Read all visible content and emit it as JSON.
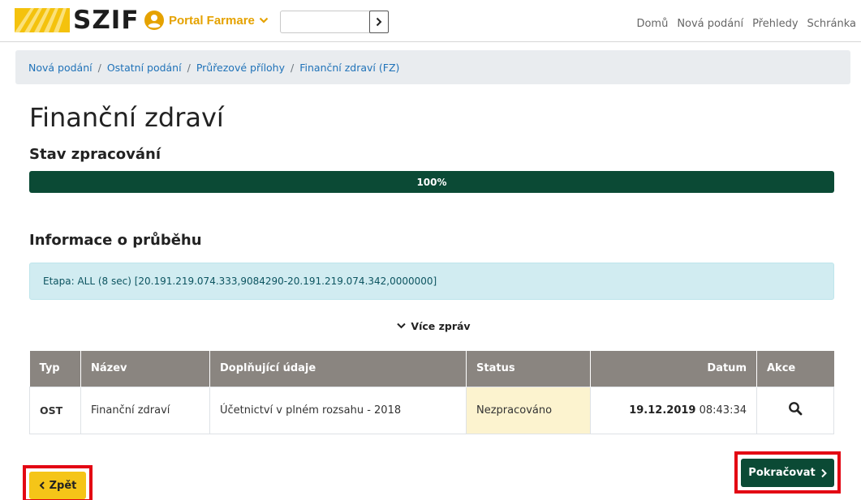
{
  "header": {
    "logo_text": "SZIF",
    "portal_label": "Portal Farmare",
    "search_value": "",
    "nav": [
      "Domů",
      "Nová podání",
      "Přehledy",
      "Schránka"
    ]
  },
  "breadcrumb": [
    "Nová podání",
    "Ostatní podání",
    "Průřezové přílohy",
    "Finanční zdraví (FZ)"
  ],
  "page_title": "Finanční zdraví",
  "stav_title": "Stav zpracování",
  "progress": {
    "value": 100,
    "label": "100%"
  },
  "info_title": "Informace o průběhu",
  "info_message": "Etapa: ALL (8 sec) [20.191.219.074.333,9084290-20.191.219.074.342,0000000]",
  "more_label": "Více zpráv",
  "table": {
    "headers": [
      "Typ",
      "Název",
      "Doplňující údaje",
      "Status",
      "Datum",
      "Akce"
    ],
    "rows": [
      {
        "typ": "OST",
        "nazev": "Finanční zdraví",
        "doplnujici": "Účetnictví v plném rozsahu - 2018",
        "status": "Nezpracováno",
        "datum_date": "19.12.2019",
        "datum_time": "08:43:34",
        "akce_icon": "search-icon"
      }
    ]
  },
  "buttons": {
    "back": "Zpět",
    "next": "Pokračovat"
  },
  "colors": {
    "primary_green": "#0b4a35",
    "accent_yellow": "#f5c518",
    "highlight_red": "#e30613",
    "info_bg": "#d1ecf1"
  }
}
